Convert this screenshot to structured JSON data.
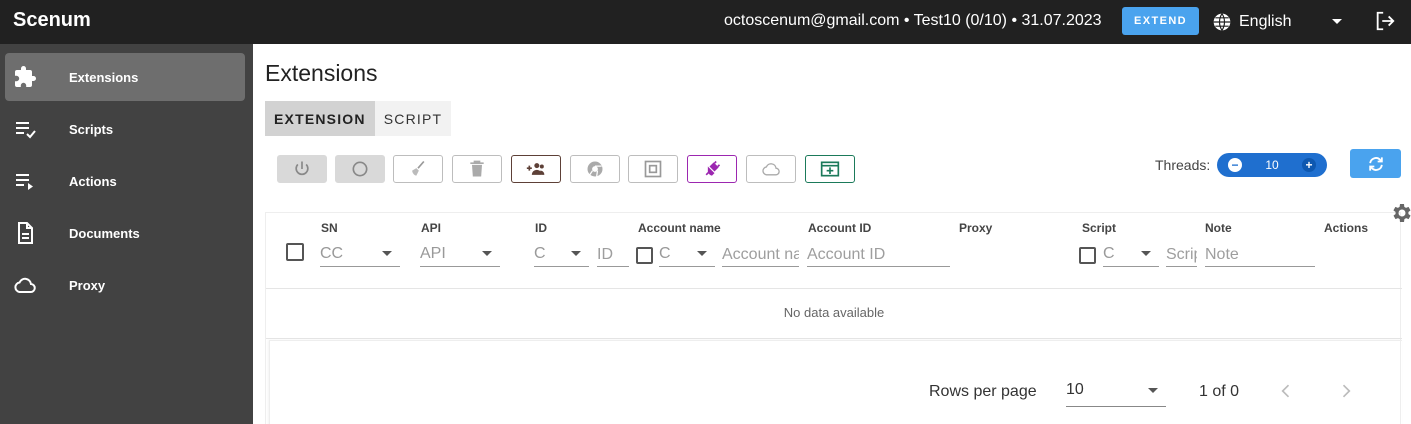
{
  "app": {
    "title": "Scenum",
    "account_info": "octoscenum@gmail.com • Test10 (0/10) • 31.07.2023",
    "extend_label": "EXTEND",
    "language": "English"
  },
  "sidebar": {
    "items": [
      {
        "label": "Extensions",
        "icon": "puzzle-icon",
        "active": true
      },
      {
        "label": "Scripts",
        "icon": "playlist-check-icon"
      },
      {
        "label": "Actions",
        "icon": "playlist-play-icon"
      },
      {
        "label": "Documents",
        "icon": "document-icon"
      },
      {
        "label": "Proxy",
        "icon": "cloud-icon"
      }
    ]
  },
  "main": {
    "title": "Extensions",
    "tabs": [
      {
        "label": "EXTENSION",
        "active": true
      },
      {
        "label": "SCRIPT"
      }
    ],
    "toolbar": {
      "threads_label": "Threads:",
      "threads_value": "10",
      "accent_purple": "#9c27b0",
      "accent_green": "#1b7a5a",
      "accent_brown": "#5d4037"
    }
  },
  "table": {
    "headers": {
      "sn": "SN",
      "api": "API",
      "id": "ID",
      "account_name": "Account name",
      "account_id": "Account ID",
      "proxy": "Proxy",
      "script": "Script",
      "note": "Note",
      "actions": "Actions"
    },
    "filters": {
      "sn_select": "CC",
      "api_select": "API",
      "id_select": "C",
      "id_input": "ID",
      "account_select": "C",
      "account_name_input": "Account na",
      "account_id_input": "Account ID",
      "script_select": "C",
      "script_input": "Scrip",
      "note_input": "Note"
    },
    "empty_text": "No data available",
    "footer": {
      "rows_per_page_label": "Rows per page",
      "rows_per_page_value": "10",
      "page_info": "1 of 0"
    }
  }
}
